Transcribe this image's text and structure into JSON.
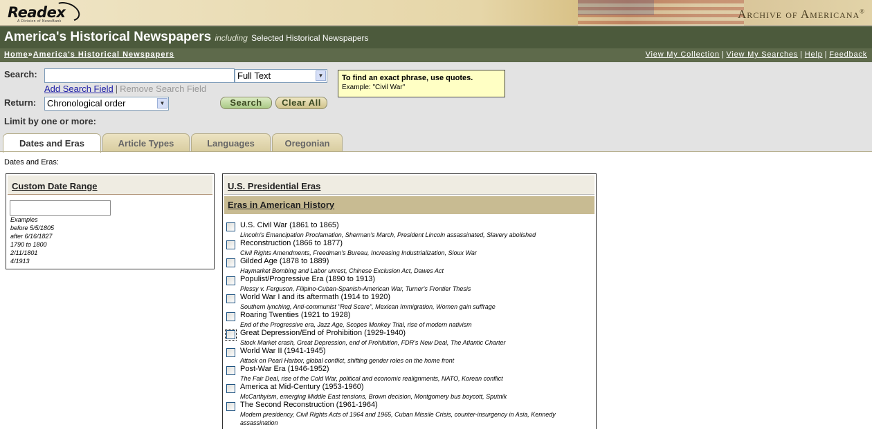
{
  "banner": {
    "logo": "Readex",
    "logo_sub": "A Division of NewsBank",
    "archive": "Archive of Americana",
    "archive_mark": "®"
  },
  "title": {
    "main": "America's Historical Newspapers",
    "including": "including",
    "selected": "Selected Historical Newspapers"
  },
  "breadcrumb": {
    "home": "Home",
    "sep": "»",
    "current": "America's Historical Newspapers"
  },
  "toplinks": {
    "collection": "View My Collection",
    "searches": "View My Searches",
    "help": "Help",
    "feedback": "Feedback",
    "sep": "|"
  },
  "search": {
    "label": "Search:",
    "value": "",
    "field_select": "Full Text",
    "add_field": "Add Search Field",
    "remove_field": "Remove Search Field",
    "return_label": "Return:",
    "return_select": "Chronological order",
    "search_button": "Search",
    "clear_button": "Clear All",
    "limit_label": "Limit by one or more:"
  },
  "hint": {
    "title": "To find an exact phrase, use quotes.",
    "example": "Example: \"Civil War\""
  },
  "tabs": [
    "Dates and Eras",
    "Article Types",
    "Languages",
    "Oregonian"
  ],
  "dates_label": "Dates and Eras:",
  "custom_range": {
    "heading": "Custom Date Range",
    "examples": [
      "Examples",
      "before 5/5/1805",
      "after 6/16/1827",
      "1790 to 1800",
      "2/11/1801",
      "4/1913"
    ]
  },
  "eras": {
    "heading_presidential": "U.S. Presidential Eras",
    "heading_history": "Eras in American History",
    "items": [
      {
        "title": "U.S. Civil War (1861 to 1865)",
        "desc": "Lincoln's Emancipation Proclamation, Sherman's March, President Lincoln assassinated, Slavery abolished"
      },
      {
        "title": "Reconstruction (1866 to 1877)",
        "desc": "Civil Rights Amendments, Freedman's Bureau, Increasing Industrialization, Sioux War"
      },
      {
        "title": "Gilded Age (1878 to 1889)",
        "desc": "Haymarket Bombing and Labor unrest, Chinese Exclusion Act, Dawes Act"
      },
      {
        "title": "Populist/Progressive Era (1890 to 1913)",
        "desc": "Plessy v. Ferguson, Filipino-Cuban-Spanish-American War, Turner's Frontier Thesis"
      },
      {
        "title": "World War I and its aftermath (1914 to 1920)",
        "desc": "Southern lynching, Anti-communist \"Red Scare\", Mexican Immigration, Women gain suffrage"
      },
      {
        "title": "Roaring Twenties (1921 to 1928)",
        "desc": "End of the Progressive era, Jazz Age, Scopes Monkey Trial, rise of modern nativism"
      },
      {
        "title": "Great Depression/End of Prohibition (1929-1940)",
        "desc": "Stock Market crash, Great Depression, end of Prohibition, FDR's New Deal, The Atlantic Charter"
      },
      {
        "title": "World War II (1941-1945)",
        "desc": "Attack on Pearl Harbor, global conflict, shifting gender roles on the home front"
      },
      {
        "title": "Post-War Era (1946-1952)",
        "desc": "The Fair Deal, rise of the Cold War, political and economic realignments, NATO, Korean conflict"
      },
      {
        "title": "America at Mid-Century (1953-1960)",
        "desc": "McCarthyism, emerging Middle East tensions, Brown decision, Montgomery bus boycott, Sputnik"
      },
      {
        "title": "The Second Reconstruction (1961-1964)",
        "desc": "Modern presidency, Civil Rights Acts of 1964 and 1965, Cuban Missile Crisis, counter-insurgency in Asia, Kennedy assassination"
      }
    ]
  }
}
